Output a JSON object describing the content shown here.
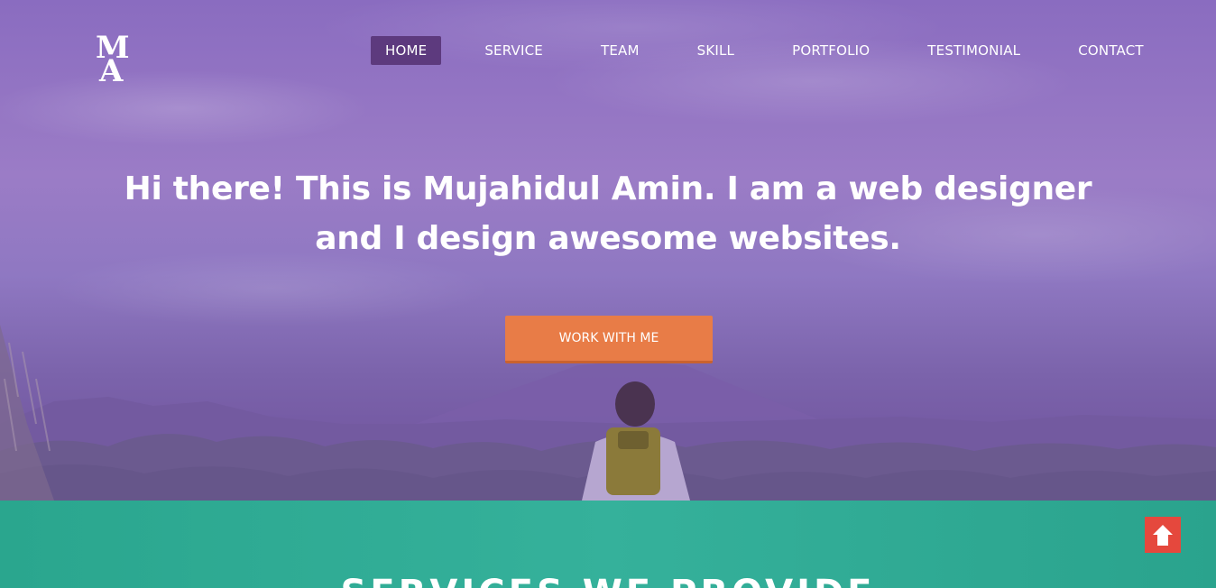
{
  "logo": {
    "text": "MA",
    "icon": "logo-monogram"
  },
  "nav": {
    "items": [
      {
        "label": "HOME",
        "active": true
      },
      {
        "label": "SERVICE",
        "active": false
      },
      {
        "label": "TEAM",
        "active": false
      },
      {
        "label": "SKILL",
        "active": false
      },
      {
        "label": "PORTFOLIO",
        "active": false
      },
      {
        "label": "TESTIMONIAL",
        "active": false
      },
      {
        "label": "CONTACT",
        "active": false
      }
    ]
  },
  "hero": {
    "headline": "Hi there! This is Mujahidul Amin. I am a web designer and I design awesome websites.",
    "cta_label": "WORK WITH ME"
  },
  "services": {
    "title": "SERVICES WE PROVIDE"
  },
  "scroll_top": {
    "icon": "arrow-up-icon"
  },
  "colors": {
    "hero_overlay": "#8a6cc0",
    "nav_active": "#5d3a7e",
    "cta": "#e87c47",
    "services_bg": "#2fad96",
    "scroll_top": "#e5483d"
  }
}
